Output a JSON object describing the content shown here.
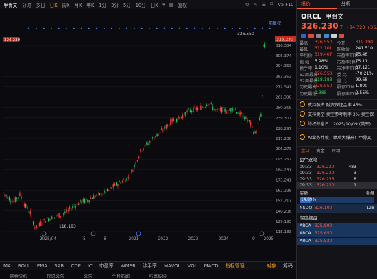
{
  "toolbar": {
    "periods": [
      "甲骨文",
      "分时",
      "多日",
      "日K",
      "周K",
      "月K",
      "年K",
      "1分",
      "3分",
      "5分",
      "10分",
      "日K"
    ],
    "active_period_index": 3,
    "right_label": "复权",
    "right_version": "V5 F10"
  },
  "chart": {
    "adj_label": "前复权",
    "high_annotation": "326.550",
    "low_annotation": "118.183",
    "current_price_tag": "326.230",
    "y_ticks": [
      "316.384",
      "305.374",
      "294.363",
      "283.352",
      "272.341",
      "261.330",
      "250.318",
      "239.307",
      "228.297",
      "217.286",
      "206.273",
      "195.262",
      "184.251",
      "173.241",
      "162.228",
      "151.217",
      "140.206",
      "129.195",
      "118.183"
    ],
    "x_labels": [
      "2025/04",
      "5",
      "6",
      "2021",
      "2022",
      "2023",
      "2024",
      "9",
      "2025"
    ],
    "up_color": "#ff3b30",
    "down_color": "#22c55e"
  },
  "indicators": {
    "items": [
      "MA",
      "BOLL",
      "EMA",
      "SAR",
      "CDP",
      "IC",
      "市盈率",
      "WMSR",
      "涉手率",
      "MAVOL",
      "VOL",
      "MACD",
      "指标管理"
    ],
    "active_index": 12,
    "right_items": [
      "对象",
      "筹码"
    ]
  },
  "bottom_tabs": [
    "资金分析",
    "快讯公告",
    "公告",
    "个股新闻",
    "所属板块"
  ],
  "right_panel": {
    "tabs": [
      "报价",
      "分析"
    ],
    "symbol": "ORCL",
    "name": "甲骨文",
    "price": "326.230",
    "change": "+84.720 +35.08%",
    "stats": [
      {
        "l_label": "最高",
        "l_val": "326.550",
        "l_color": "red",
        "r_label": "今开",
        "r_val": "319.190",
        "r_color": "red"
      },
      {
        "l_label": "最低",
        "l_val": "312.101",
        "l_color": "red",
        "r_label": "昨收价",
        "r_val": "241.510",
        "r_color": "white"
      },
      {
        "l_label": "平均价",
        "l_val": "319.407",
        "l_color": "red",
        "r_label": "市盈率TTM",
        "r_val": "75.46",
        "r_color": "white"
      },
      {
        "l_label": "振 幅",
        "l_val": "5.98%",
        "l_color": "white",
        "r_label": "市盈率(静)",
        "r_val": "75.11",
        "r_color": "white"
      },
      {
        "l_label": "换手率",
        "l_val": "1.10%",
        "l_color": "white",
        "r_label": "市净率TTM",
        "r_val": "37.121",
        "r_color": "white"
      },
      {
        "l_label": "52周最高",
        "l_val": "326.550",
        "l_color": "red",
        "r_label": "委 比",
        "r_val": "-70.21%",
        "r_color": "white"
      },
      {
        "l_label": "52周最低",
        "l_val": "118.183",
        "l_color": "green",
        "r_label": "量 比",
        "r_val": "99.68",
        "r_color": "white"
      },
      {
        "l_label": "历史最高",
        "l_val": "326.550",
        "l_color": "red",
        "r_label": "股息TTM",
        "r_val": "1.800",
        "r_color": "white"
      },
      {
        "l_label": "历史最低",
        "l_val": "2.385",
        "l_color": "green",
        "r_label": "股息率TTM",
        "r_val": "0.55%",
        "r_color": "white"
      }
    ],
    "info": [
      "支持融资 融资保证金率 45%",
      "支持卖空 卖空参考利率 3% 卖空保",
      "除权除息日：2025/10/09 (美东)",
      "AI业务井喷，绩后大爆升！甲骨文"
    ],
    "order_tabs": [
      "盘口",
      "资金",
      "异动"
    ],
    "ticks_title": "盘中逐笔",
    "ticks": [
      {
        "time": "09:33",
        "price": "326.220",
        "qty": "483"
      },
      {
        "time": "09:33",
        "price": "326.230",
        "qty": "3"
      },
      {
        "time": "09:33",
        "price": "326.256",
        "qty": "8"
      },
      {
        "time": "09:33",
        "price": "326.230",
        "qty": "1"
      }
    ],
    "buy_label": "买盘",
    "sell_label": "卖盘",
    "bar_percent": "14.89%",
    "bar_fraction": 0.1489,
    "bid_row": {
      "ex": "NSDQ",
      "price": "326.100",
      "qty": "128"
    },
    "depth_title": "深度摆盘",
    "depth": [
      {
        "ex": "ARCA",
        "price": "325.890"
      },
      {
        "ex": "ARCA",
        "price": "325.650"
      },
      {
        "ex": "ARCA",
        "price": "325.520"
      }
    ]
  }
}
